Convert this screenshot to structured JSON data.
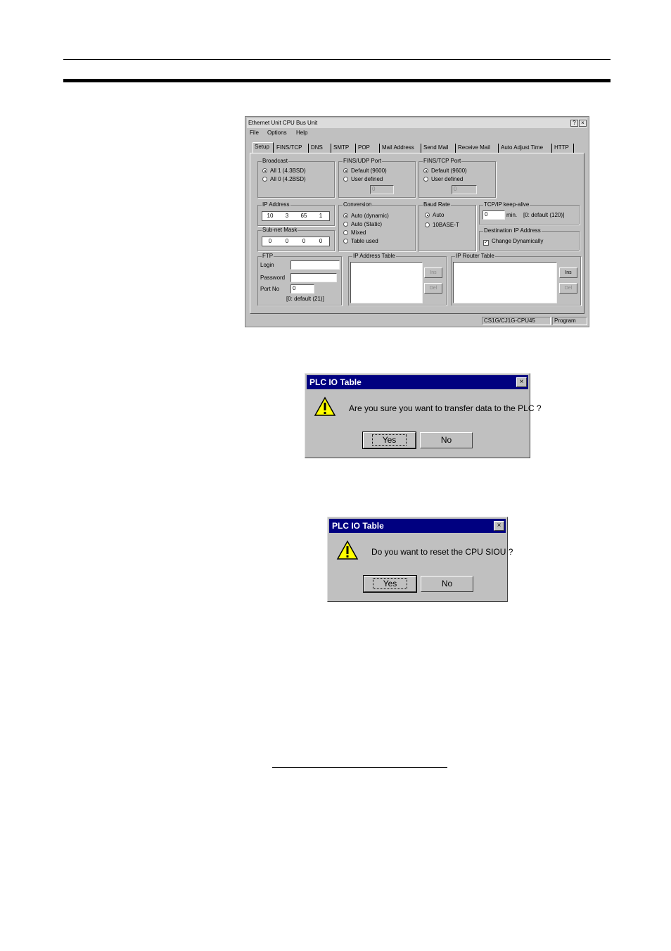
{
  "ethernet_dialog": {
    "title": "Ethernet Unit CPU Bus Unit",
    "help_button": "?",
    "close_button": "×",
    "menu": [
      "File",
      "Options",
      "Help"
    ],
    "tabs": [
      "Setup",
      "FINS/TCP",
      "DNS",
      "SMTP",
      "POP",
      "Mail Address",
      "Send Mail",
      "Receive Mail",
      "Auto Adjust Time",
      "HTTP"
    ],
    "broadcast": {
      "title": "Broadcast",
      "options": [
        "All 1 (4.3BSD)",
        "All 0 (4.2BSD)"
      ],
      "selected": 0
    },
    "fins_udp": {
      "title": "FINS/UDP Port",
      "options": [
        "Default (9600)",
        "User defined"
      ],
      "selected": 0,
      "value": "0"
    },
    "fins_tcp": {
      "title": "FINS/TCP Port",
      "options": [
        "Default (9600)",
        "User defined"
      ],
      "selected": 0,
      "value": "0"
    },
    "ip_address": {
      "title": "IP Address",
      "octets": [
        "10",
        "3",
        "65",
        "1"
      ]
    },
    "subnet_mask": {
      "title": "Sub-net Mask",
      "octets": [
        "0",
        "0",
        "0",
        "0"
      ]
    },
    "conversion": {
      "title": "Conversion",
      "options": [
        "Auto (dynamic)",
        "Auto (Static)",
        "Mixed",
        "Table used"
      ],
      "selected": 0
    },
    "baud_rate": {
      "title": "Baud Rate",
      "options": [
        "Auto",
        "10BASE-T"
      ],
      "selected": 0
    },
    "keepalive": {
      "title": "TCP/IP keep-alive",
      "value": "0",
      "unit": "min.",
      "hint": "[0: default (120)]"
    },
    "dest_ip": {
      "title": "Destination IP Address",
      "checkbox_label": "Change Dynamically",
      "checked": true
    },
    "ftp": {
      "title": "FTP",
      "login_label": "Login",
      "login_value": "",
      "password_label": "Password",
      "password_value": "",
      "port_label": "Port No",
      "port_value": "0",
      "hint": "[0: default (21)]"
    },
    "ip_address_table": {
      "title": "IP Address Table",
      "ins": "Ins",
      "del": "Del"
    },
    "ip_router_table": {
      "title": "IP Router Table",
      "ins": "Ins",
      "del": "Del"
    },
    "status": {
      "model": "CS1G/CJ1G-CPU45",
      "mode": "Program"
    }
  },
  "dialog1": {
    "title": "PLC IO Table",
    "message": "Are you sure you want to transfer data to the PLC ?",
    "yes": "Yes",
    "no": "No",
    "close": "×",
    "icon": "warning-icon"
  },
  "dialog2": {
    "title": "PLC IO Table",
    "message": "Do you want to reset the CPU SIOU ?",
    "yes": "Yes",
    "no": "No",
    "close": "×",
    "icon": "warning-icon"
  }
}
